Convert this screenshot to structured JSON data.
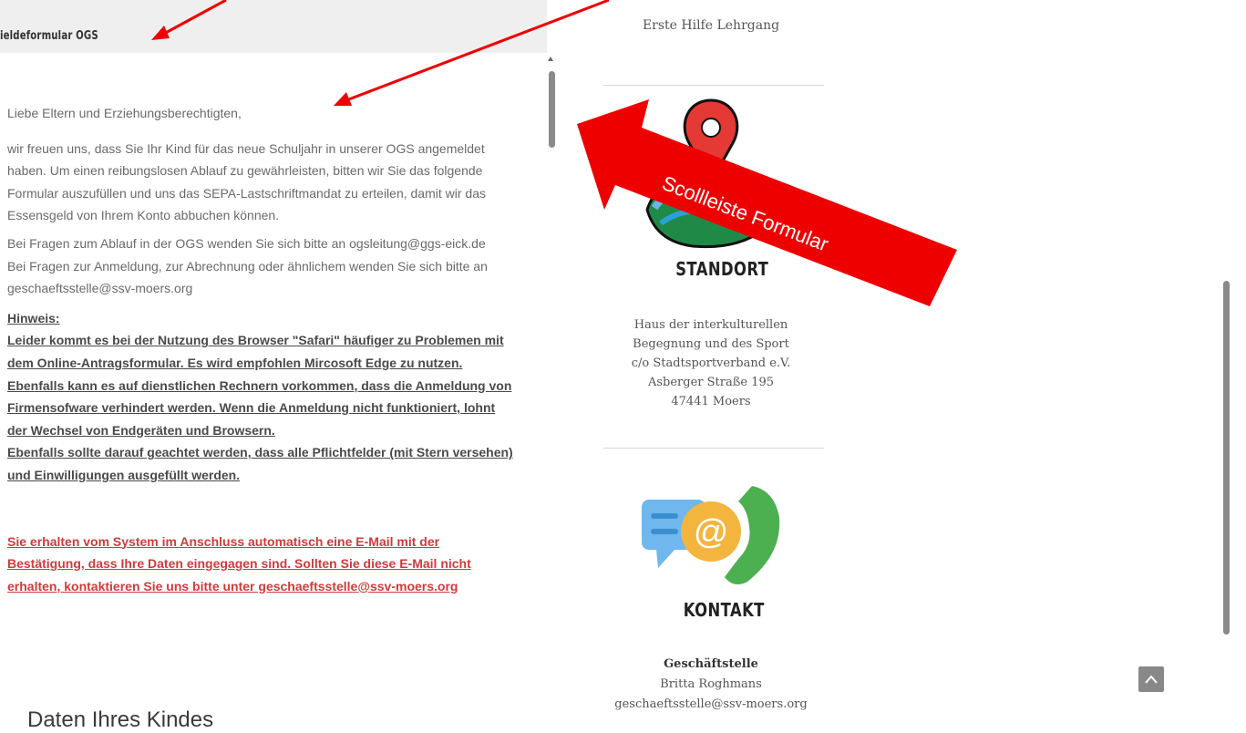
{
  "form": {
    "title": "ieldeformular OGS",
    "salutation": "Liebe Eltern und Erziehungsberechtigten,",
    "intro": "wir freuen uns, dass Sie Ihr Kind für das neue Schuljahr in unserer OGS angemeldet haben. Um einen reibungslosen Ablauf zu gewährleisten, bitten wir Sie das folgende Formular auszufüllen und uns das SEPA-Lastschriftmandat zu erteilen, damit wir das Essensgeld von Ihrem Konto abbuchen können.",
    "questions_ogs": "Bei Fragen zum Ablauf in der OGS wenden Sie sich bitte an ogsleitung@ggs-eick.de",
    "questions_registration": "Bei Fragen zur Anmeldung, zur Abrechnung oder ähnlichem wenden Sie sich bitte an geschaeftsstelle@ssv-moers.org",
    "hint_label": "Hinweis:",
    "hint_text_1": "Leider kommt es bei der Nutzung des Browser \"Safari\" häufiger zu Problemen mit dem Online-Antragsformular. Es wird empfohlen Mircosoft Edge zu nutzen. Ebenfalls kann es auf dienstlichen Rechnern vorkommen, dass die Anmeldung von Firmensofware verhindert werden. Wenn die Anmeldung nicht funktioniert, lohnt der Wechsel von Endgeräten und Browsern.",
    "hint_text_2": "Ebenfalls sollte darauf geachtet werden, dass alle Pflichtfelder (mit Stern versehen) und Einwilligungen ausgefüllt werden.",
    "confirmation_notice": "Sie erhalten vom System im Anschluss automatisch eine E-Mail mit der Bestätigung, dass Ihre Daten eingegagen sind. Sollten Sie diese E-Mail nicht erhalten, kontaktieren Sie uns bitte unter geschaeftsstelle@ssv-moers.org",
    "section_heading": "Daten Ihres Kindes"
  },
  "sidebar": {
    "course": "Erste Hilfe Lehrgang",
    "standort_label": "STANDORT",
    "address": [
      "Haus der interkulturellen",
      "Begegnung und des Sport",
      "c/o Stadtsportverband e.V.",
      "Asberger Straße 195",
      "47441 Moers"
    ],
    "kontakt_label": "KONTAKT",
    "contact_heading": "Geschäftstelle",
    "contact_name": "Britta Roghmans",
    "contact_email": "geschaeftsstelle@ssv-moers.org"
  },
  "annotation": {
    "label": "Scollleiste Formular"
  },
  "icons": {
    "standort": "map-pin-icon",
    "kontakt": "chat-phone-icon",
    "back_to_top": "chevron-up-icon"
  },
  "colors": {
    "annotation_red": "#ee0000",
    "notice_red": "#d03b3b"
  }
}
